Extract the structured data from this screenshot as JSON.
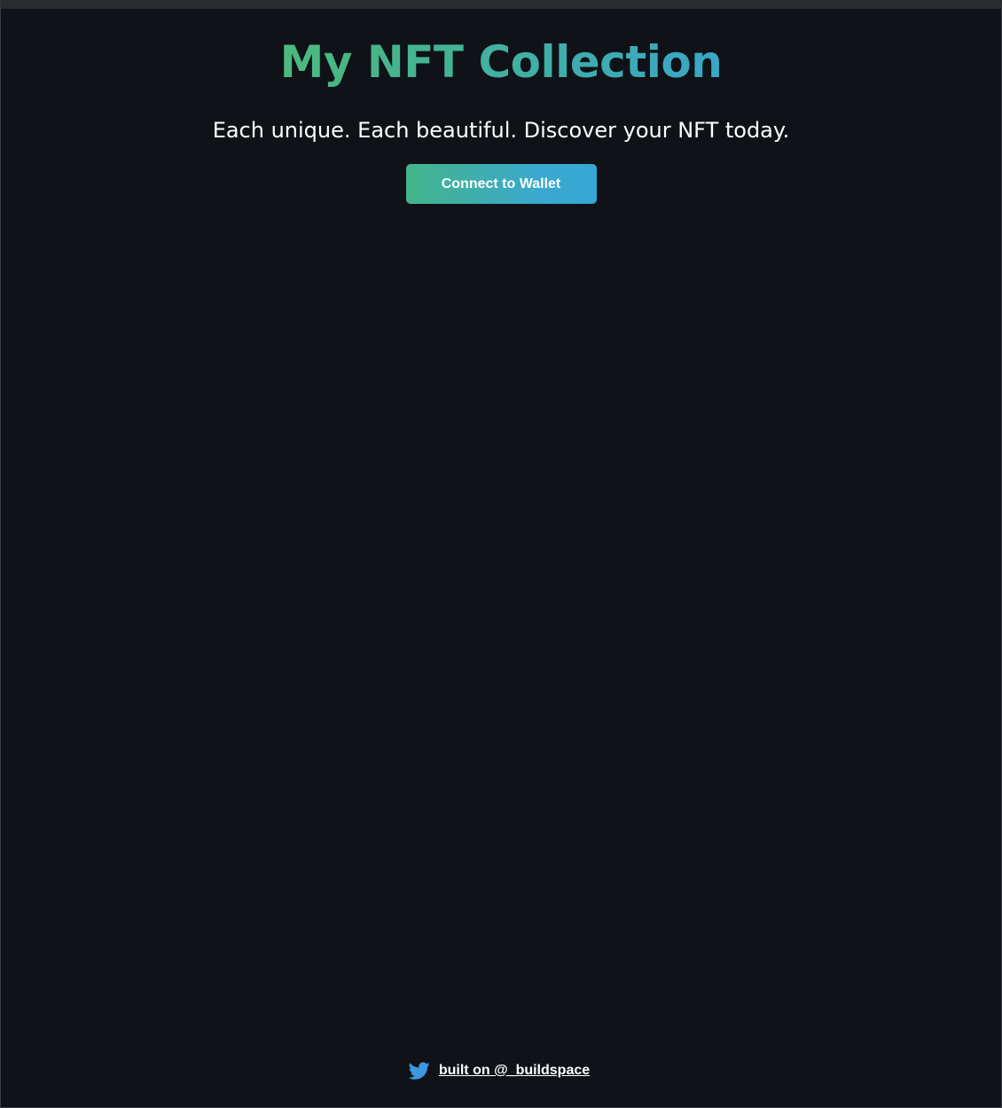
{
  "header": {
    "title": "My NFT Collection",
    "subtitle": "Each unique. Each beautiful. Discover your NFT today.",
    "connect_button_label": "Connect to Wallet"
  },
  "footer": {
    "icon": "twitter-icon",
    "link_text": "built on @_buildspace"
  },
  "colors": {
    "background": "#0f1217",
    "gradient_start": "#5cc45a",
    "gradient_end": "#3aa3dd",
    "twitter_blue": "#3d98e0"
  }
}
